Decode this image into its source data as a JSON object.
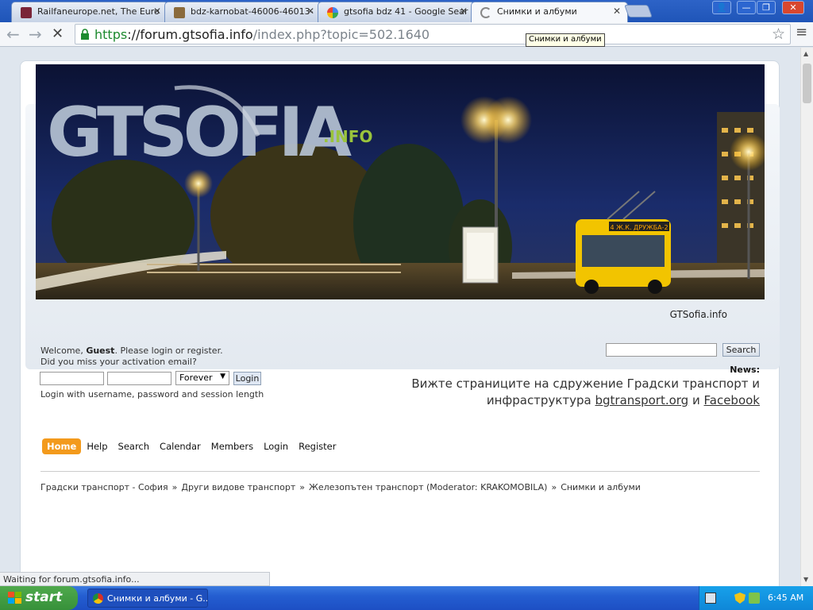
{
  "browser": {
    "tabs": [
      {
        "title": "Railfaneurope.net, The Euro",
        "favicon": "railfaneurope-favicon",
        "active": false
      },
      {
        "title": "bdz-karnobat-46006-46013-",
        "favicon": "photo-favicon",
        "active": false
      },
      {
        "title": "gtsofia bdz 41 - Google Sear",
        "favicon": "google-favicon",
        "active": false
      },
      {
        "title": "Снимки и албуми",
        "favicon": "loading-favicon",
        "active": true
      }
    ],
    "url": {
      "scheme": "https",
      "host": "://forum.gtsofia.info",
      "path": "/index.php?topic=502.1640"
    },
    "tooltip": "Снимки и албуми",
    "status": "Waiting for forum.gtsofia.info..."
  },
  "header": {
    "logo_text": "GTSOFIA",
    "logo_suffix": ".INFO",
    "bus_sign": "4 Ж.К. ДРУЖБА-2",
    "site_title": "GTSofia.info"
  },
  "login": {
    "welcome_prefix": "Welcome, ",
    "guest": "Guest",
    "welcome_suffix": ". Please login or register.",
    "activation": "Did you miss your activation email?",
    "length_option": "Forever",
    "login_button": "Login",
    "hint": "Login with username, password and session length"
  },
  "search": {
    "button": "Search"
  },
  "news": {
    "title": "News:",
    "line1": "Вижте страниците на сдружение Градски транспорт и",
    "line2_prefix": "инфраструктура ",
    "link1": "bgtransport.org",
    "and": " и ",
    "link2": "Facebook"
  },
  "menu": {
    "items": [
      "Home",
      "Help",
      "Search",
      "Calendar",
      "Members",
      "Login",
      "Register"
    ]
  },
  "breadcrumb": {
    "items": [
      "Градски транспорт - София",
      "Други видове транспорт",
      "Железопътен транспорт (Moderator: KRAKOMOBILA)",
      "Снимки и албуми"
    ]
  },
  "taskbar": {
    "start": "start",
    "window": "Снимки и албуми - G...",
    "clock": "6:45 AM"
  },
  "colors": {
    "menu_active": "#f39a1c",
    "url_https": "#1d8a2f",
    "taskbar": "#245ed1",
    "start_button": "#37913a"
  }
}
